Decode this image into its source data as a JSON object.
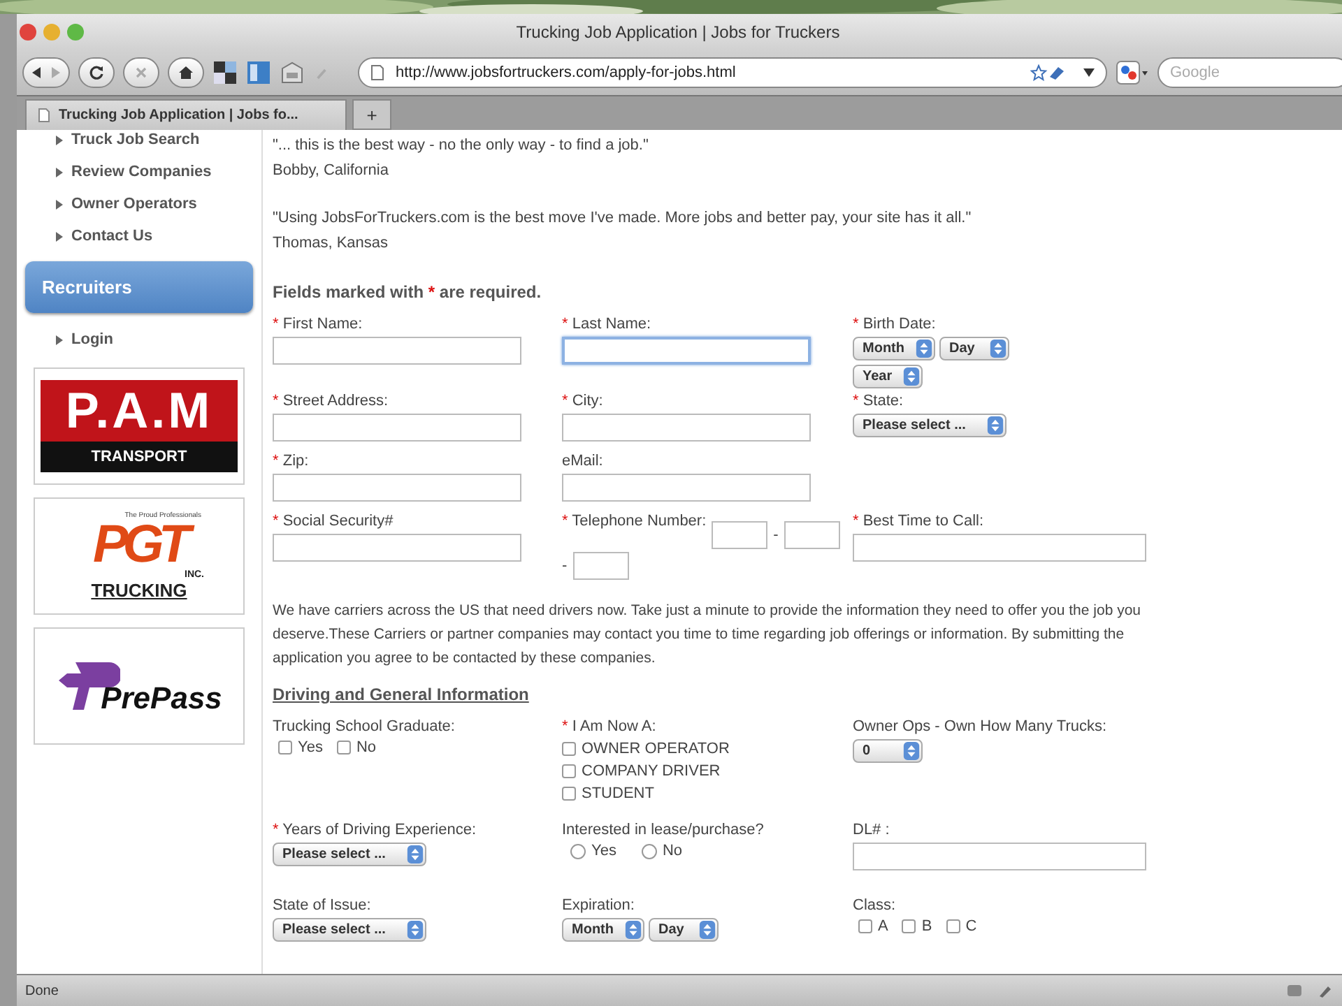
{
  "window": {
    "title": "Trucking Job Application | Jobs for Truckers"
  },
  "toolbar": {
    "url": "http://www.jobsfortruckers.com/apply-for-jobs.html",
    "search": {
      "placeholder": "Google"
    }
  },
  "tabs": [
    {
      "label": "Trucking Job Application | Jobs fo...",
      "selected": true
    }
  ],
  "new_tab": "+",
  "sidebar": {
    "items": [
      "Truck Job Search",
      "Review Companies",
      "Owner Operators",
      "Contact Us"
    ],
    "section": "Recruiters",
    "section_items": [
      "Login"
    ]
  },
  "sponsors": {
    "pam": {
      "name": "P.A.M",
      "sub": "TRANSPORT"
    },
    "pgt": {
      "tagline": "The Proud Professionals",
      "name": "PGT",
      "inc": "INC.",
      "sub": "TRUCKING"
    },
    "prepass": {
      "name": "PrePass"
    }
  },
  "testimonials": [
    {
      "quote": "\"... this is the best way - no the only way - to find a job.\"",
      "author": "Bobby, California"
    },
    {
      "quote": "\"Using JobsForTruckers.com is the best move I've made. More jobs and better pay, your site has it all.\"",
      "author": "Thomas, Kansas"
    }
  ],
  "required_note": {
    "before": "Fields marked with",
    "mark": "*",
    "after": "are required."
  },
  "rows": [
    [
      {
        "label": "First Name:",
        "required": true,
        "kind": "text",
        "focused": false
      },
      {
        "label": "Last Name:",
        "required": true,
        "kind": "text",
        "focused": true
      },
      {
        "label": "Birth Date:",
        "required": true,
        "kind": "selects",
        "selects": [
          "Month",
          "Day",
          "Year"
        ]
      }
    ],
    [
      {
        "label": "Street Address:",
        "required": true,
        "kind": "text",
        "focused": false
      },
      {
        "label": "City:",
        "required": true,
        "kind": "text",
        "focused": false
      },
      {
        "label": "State:",
        "required": true,
        "kind": "selects",
        "selects": [
          "Please select ..."
        ]
      }
    ],
    [
      {
        "label": "Zip:",
        "required": true,
        "kind": "text",
        "focused": false
      },
      {
        "label": "eMail:",
        "required": false,
        "kind": "text",
        "focused": false
      }
    ],
    [
      {
        "label": "Social Security#",
        "required": true,
        "kind": "text",
        "focused": false
      },
      {
        "label": "Telephone Number:",
        "required": true,
        "kind": "phone",
        "separators": [
          "-",
          "-"
        ]
      },
      {
        "label": "Best Time to Call:",
        "required": true,
        "kind": "text",
        "focused": false
      }
    ]
  ],
  "notice": "We have carriers across the US that need drivers now. Take just a minute to provide the information they need to offer you the job you deserve.These Carriers or partner companies may contact you time to time regarding job offerings or information. By submitting the application you agree to be contacted by these companies.",
  "section_heading": "Driving and General Information",
  "rows2": [
    [
      {
        "label": "Trucking School Graduate:",
        "required": false,
        "kind": "checks",
        "options": [
          {
            "label": "Yes",
            "checked": false
          },
          {
            "label": "No",
            "checked": false
          }
        ]
      },
      {
        "label": "I Am Now A:",
        "required": true,
        "kind": "checks-stacked",
        "options": [
          {
            "label": "OWNER OPERATOR",
            "checked": false
          },
          {
            "label": "COMPANY DRIVER",
            "checked": false
          },
          {
            "label": "STUDENT",
            "checked": false
          }
        ]
      },
      {
        "label": "Owner Ops - Own How Many Trucks:",
        "required": false,
        "kind": "selects",
        "selects": [
          "0"
        ]
      }
    ],
    [
      {
        "label": "Years of Driving Experience:",
        "required": true,
        "kind": "selects",
        "selects": [
          "Please select ..."
        ]
      },
      {
        "label": "Interested in lease/purchase?",
        "required": false,
        "kind": "radios",
        "options": [
          {
            "label": "Yes",
            "selected": false
          },
          {
            "label": "No",
            "selected": false
          }
        ]
      },
      {
        "label": "DL# :",
        "required": false,
        "kind": "text",
        "focused": false
      }
    ],
    [
      {
        "label": "State of Issue:",
        "required": false,
        "kind": "selects",
        "selects": [
          "Please select ..."
        ]
      },
      {
        "label": "Expiration:",
        "required": false,
        "kind": "selects",
        "selects": [
          "Month",
          "Day"
        ]
      },
      {
        "label": "Class:",
        "required": false,
        "kind": "checks",
        "options": [
          {
            "label": "A",
            "checked": false
          },
          {
            "label": "B",
            "checked": false
          },
          {
            "label": "C",
            "checked": false
          }
        ]
      }
    ]
  ],
  "status_bar": {
    "text": "Done"
  }
}
